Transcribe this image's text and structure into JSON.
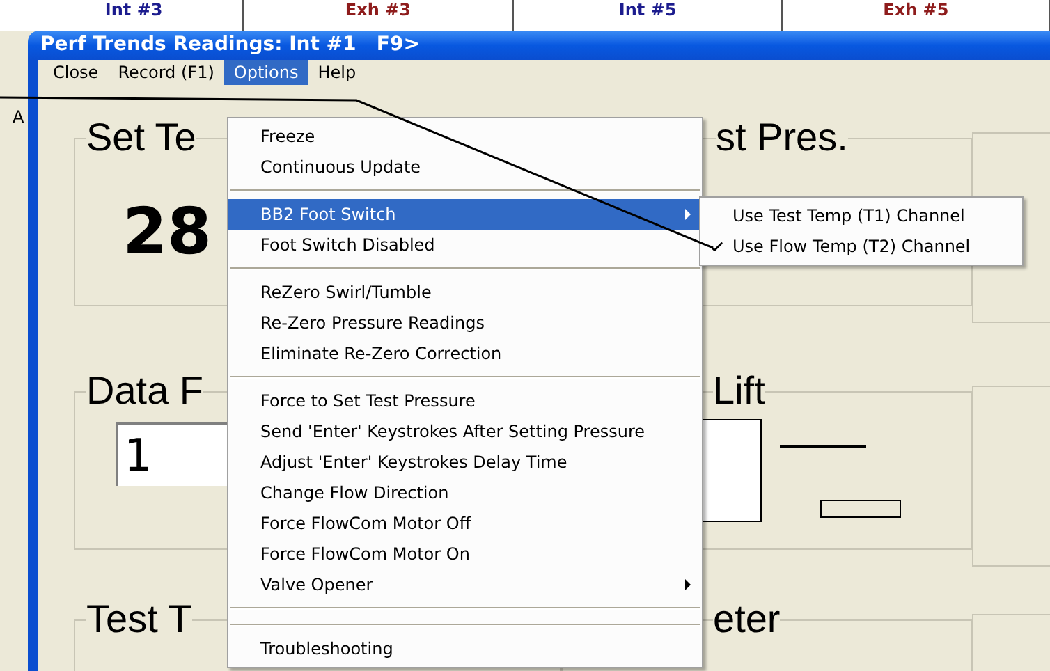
{
  "background_header": {
    "columns": [
      {
        "label": "Int #3",
        "kind": "int"
      },
      {
        "label": "Exh #3",
        "kind": "exh"
      },
      {
        "label": "Int #5",
        "kind": "int"
      },
      {
        "label": "Exh #5",
        "kind": "exh"
      }
    ]
  },
  "background_label": "A",
  "window": {
    "title": "Perf Trends Readings: Int #1   F9>"
  },
  "menu_bar": [
    {
      "label": "Close",
      "selected": false
    },
    {
      "label": "Record (F1)",
      "selected": false
    },
    {
      "label": "Options",
      "selected": true
    },
    {
      "label": "Help",
      "selected": false
    }
  ],
  "options_menu": {
    "items": [
      {
        "kind": "item",
        "label": "Freeze",
        "selected": false
      },
      {
        "kind": "item",
        "label": "Continuous Update",
        "selected": false
      },
      {
        "kind": "separator"
      },
      {
        "kind": "submenu",
        "label": "BB2 Foot Switch",
        "selected": true
      },
      {
        "kind": "item",
        "label": "Foot Switch Disabled",
        "selected": false
      },
      {
        "kind": "separator"
      },
      {
        "kind": "item",
        "label": "ReZero Swirl/Tumble",
        "selected": false
      },
      {
        "kind": "item",
        "label": "Re-Zero Pressure Readings",
        "selected": false
      },
      {
        "kind": "item",
        "label": "Eliminate Re-Zero Correction",
        "selected": false
      },
      {
        "kind": "separator"
      },
      {
        "kind": "item",
        "label": "Force to Set Test Pressure",
        "selected": false
      },
      {
        "kind": "item",
        "label": "Send 'Enter' Keystrokes After Setting Pressure",
        "selected": false
      },
      {
        "kind": "item",
        "label": "Adjust 'Enter' Keystrokes Delay Time",
        "selected": false
      },
      {
        "kind": "item",
        "label": "Change Flow Direction",
        "selected": false
      },
      {
        "kind": "item",
        "label": "Force FlowCom Motor Off",
        "selected": false
      },
      {
        "kind": "item",
        "label": "Force FlowCom Motor On",
        "selected": false
      },
      {
        "kind": "submenu",
        "label": "Valve Opener",
        "selected": false
      },
      {
        "kind": "separator"
      },
      {
        "kind": "separator"
      },
      {
        "kind": "item",
        "label": "Troubleshooting",
        "selected": false
      }
    ]
  },
  "submenu": {
    "items": [
      {
        "label": "Use Test Temp (T1) Channel",
        "checked": false
      },
      {
        "label": "Use Flow Temp (T2) Channel",
        "checked": true
      }
    ]
  },
  "panels": [
    {
      "kind": "value",
      "title": "Set Te",
      "value": "28"
    },
    {
      "kind": "empty",
      "title": "st Pres."
    },
    {
      "kind": "field",
      "title": "Data F",
      "value": "1"
    },
    {
      "kind": "gauge",
      "title": "Lift"
    },
    {
      "kind": "empty",
      "title": "Test T"
    },
    {
      "kind": "empty",
      "title": "eter"
    }
  ]
}
